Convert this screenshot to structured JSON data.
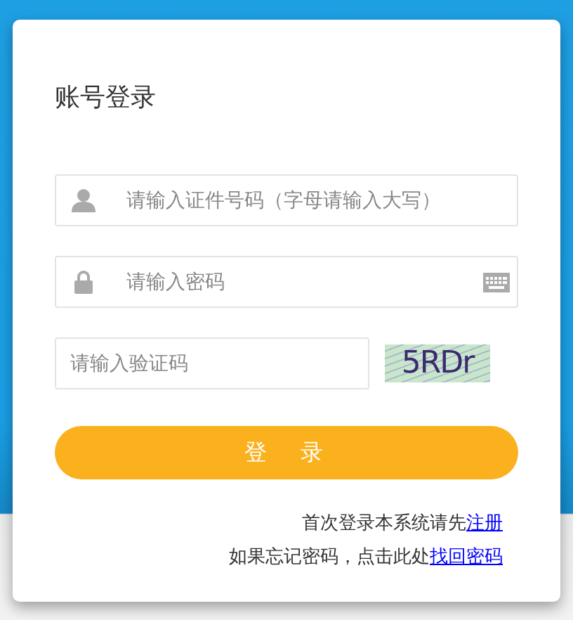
{
  "title": "账号登录",
  "fields": [
    {
      "kind": "user",
      "placeholder": "请输入证件号码（字母请输入大写）"
    },
    {
      "kind": "password",
      "placeholder": "请输入密码"
    },
    {
      "kind": "captcha",
      "placeholder": "请输入验证码"
    }
  ],
  "captcha": {
    "code": "5RDr"
  },
  "login_button": "登　录",
  "notes": [
    {
      "text": "首次登录本系统请先",
      "link": "注册"
    },
    {
      "text": "如果忘记密码，点击此处",
      "link": "找回密码"
    }
  ]
}
